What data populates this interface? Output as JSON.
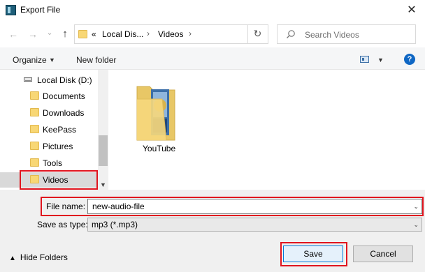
{
  "window": {
    "title": "Export File",
    "close_symbol": "✕"
  },
  "navbar": {
    "back_symbol": "←",
    "forward_symbol": "→",
    "recent_symbol": "⌄",
    "up_symbol": "↑",
    "breadcrumbs": [
      "«",
      "Local Dis...",
      "Videos"
    ],
    "crumb_separator": "›",
    "refresh_symbol": "↻",
    "search_placeholder": "Search Videos"
  },
  "toolbar": {
    "organize_label": "Organize",
    "new_folder_label": "New folder",
    "help_symbol": "?"
  },
  "sidebar": {
    "items": [
      {
        "label": "Local Disk (D:)",
        "kind": "disk"
      },
      {
        "label": "Documents",
        "kind": "folder"
      },
      {
        "label": "Downloads",
        "kind": "folder"
      },
      {
        "label": "KeePass",
        "kind": "folder"
      },
      {
        "label": "Pictures",
        "kind": "folder"
      },
      {
        "label": "Tools",
        "kind": "folder"
      },
      {
        "label": "Videos",
        "kind": "folder",
        "selected": true
      }
    ]
  },
  "content": {
    "items": [
      {
        "label": "YouTube"
      }
    ]
  },
  "file_name": {
    "label": "File name:",
    "value": "new-audio-file"
  },
  "save_type": {
    "label": "Save as type:",
    "value": "mp3 (*.mp3)"
  },
  "footer": {
    "hide_folders_label": "Hide Folders",
    "save_label": "Save",
    "cancel_label": "Cancel"
  },
  "colors": {
    "highlight": "#e0141e",
    "accent": "#0078d7",
    "folder": "#f8d775"
  }
}
